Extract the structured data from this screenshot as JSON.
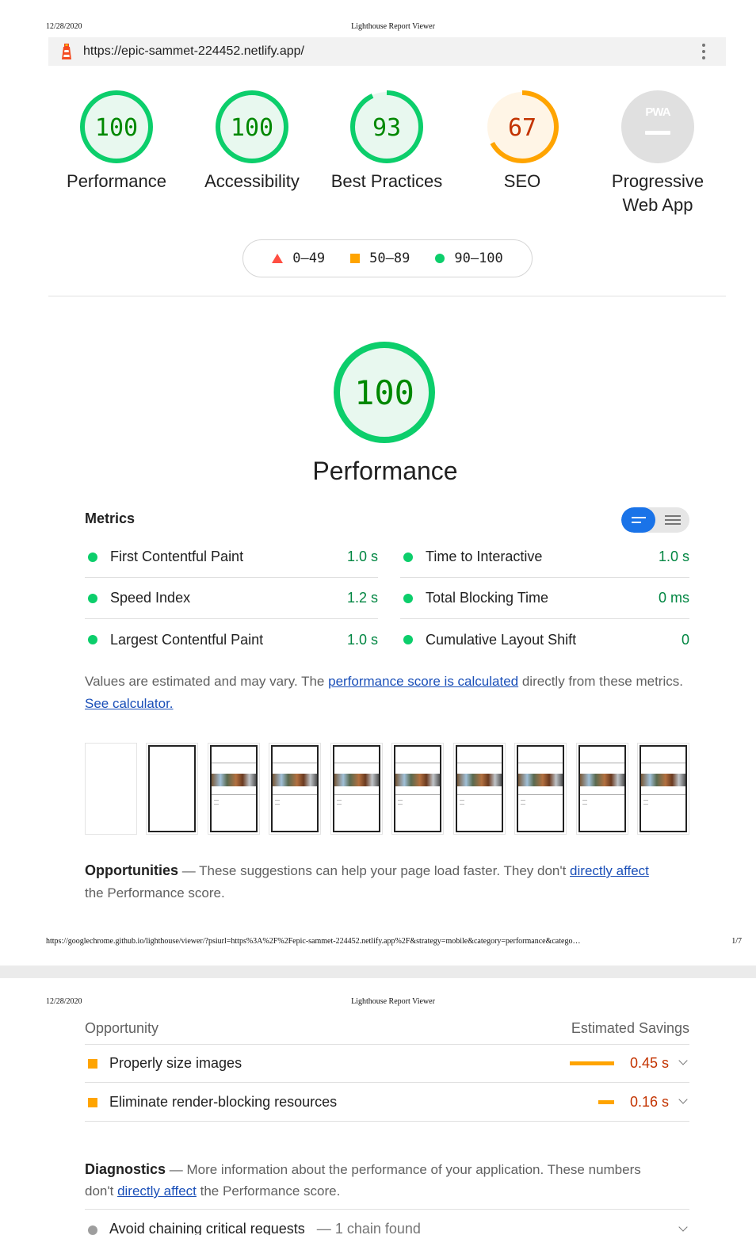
{
  "print": {
    "date": "12/28/2020",
    "title": "Lighthouse Report Viewer",
    "footer_url": "https://googlechrome.github.io/lighthouse/viewer/?psiurl=https%3A%2F%2Fepic-sammet-224452.netlify.app%2F&strategy=mobile&category=performance&catego…",
    "page_number": "1/7"
  },
  "toolbar": {
    "url": "https://epic-sammet-224452.netlify.app/",
    "logo_icon": "lighthouse-logo-icon",
    "menu_icon": "more-vert-icon"
  },
  "gauges": [
    {
      "score": "100",
      "value": 100,
      "label": "Performance",
      "color": "#0cce6b"
    },
    {
      "score": "100",
      "value": 100,
      "label": "Accessibility",
      "color": "#0cce6b"
    },
    {
      "score": "93",
      "value": 93,
      "label": "Best Practices",
      "color": "#0cce6b"
    },
    {
      "score": "67",
      "value": 67,
      "label": "SEO",
      "color": "#ffa400"
    }
  ],
  "pwa": {
    "badge": "PWA",
    "label_line1": "Progressive",
    "label_line2": "Web App"
  },
  "legend": {
    "fail": "0–49",
    "average": "50–89",
    "pass": "90–100"
  },
  "colors": {
    "pass": "#0cce6b",
    "average": "#ffa400",
    "fail": "#ff4e42",
    "link": "#1a4fb8",
    "toggle": "#1a73e8"
  },
  "performance": {
    "score": "100",
    "value": 100,
    "title": "Performance",
    "metrics_heading": "Metrics",
    "metrics": [
      {
        "label": "First Contentful Paint",
        "value": "1.0 s"
      },
      {
        "label": "Time to Interactive",
        "value": "1.0 s"
      },
      {
        "label": "Speed Index",
        "value": "1.2 s"
      },
      {
        "label": "Total Blocking Time",
        "value": "0 ms"
      },
      {
        "label": "Largest Contentful Paint",
        "value": "1.0 s"
      },
      {
        "label": "Cumulative Layout Shift",
        "value": "0"
      }
    ],
    "note_prefix": "Values are estimated and may vary. The ",
    "note_link": "performance score is calculated",
    "note_mid": " directly from these metrics.",
    "note_link2": "See calculator.",
    "opportunities_heading": "Opportunities",
    "opportunities_dash": " — These suggestions can help your page load faster. They don't ",
    "opportunities_link": "directly affect",
    "opportunities_tail": " the Performance score."
  },
  "opportunity_table": {
    "col_left": "Opportunity",
    "col_right": "Estimated Savings",
    "rows": [
      {
        "label": "Properly size images",
        "value": "0.45 s",
        "savings_fraction": 1.0
      },
      {
        "label": "Eliminate render-blocking resources",
        "value": "0.16 s",
        "savings_fraction": 0.36
      }
    ]
  },
  "diagnostics": {
    "heading": "Diagnostics",
    "dash": " — More information about the performance of your application. These numbers don't ",
    "link": "directly affect",
    "tail": " the Performance score.",
    "row_label": "Avoid chaining critical requests",
    "row_sep": " — ",
    "row_detail": "1 chain found"
  }
}
